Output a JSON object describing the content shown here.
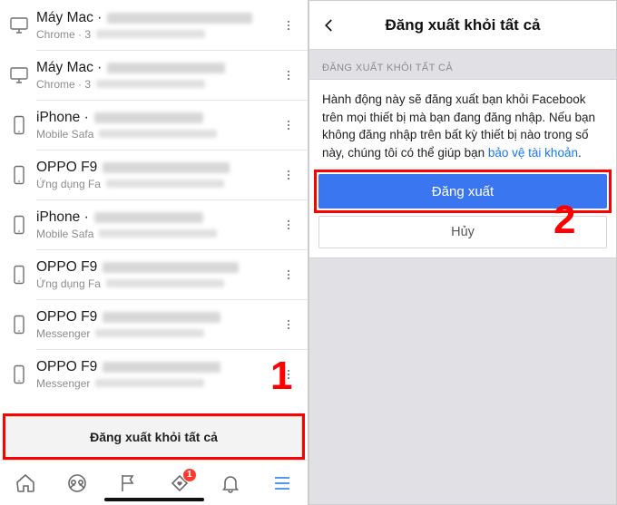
{
  "left": {
    "sessions": [
      {
        "icon": "monitor",
        "title": "Máy Mac ·",
        "title_blur_w": 160,
        "sub": "Chrome · 3",
        "sub_blur_w": 120
      },
      {
        "icon": "monitor",
        "title": "Máy Mac ·",
        "title_blur_w": 130,
        "sub": "Chrome · 3",
        "sub_blur_w": 120
      },
      {
        "icon": "phone",
        "title": "iPhone ·",
        "title_blur_w": 120,
        "sub": "Mobile Safa",
        "sub_blur_w": 130
      },
      {
        "icon": "phone",
        "title": "OPPO F9",
        "title_blur_w": 140,
        "sub": "Ứng dụng Fa",
        "sub_blur_w": 130
      },
      {
        "icon": "phone",
        "title": "iPhone ·",
        "title_blur_w": 120,
        "sub": "Mobile Safa",
        "sub_blur_w": 130
      },
      {
        "icon": "phone",
        "title": "OPPO F9",
        "title_blur_w": 150,
        "sub": "Ứng dụng Fa",
        "sub_blur_w": 130
      },
      {
        "icon": "phone",
        "title": "OPPO F9",
        "title_blur_w": 130,
        "sub": "Messenger",
        "sub_blur_w": 120
      },
      {
        "icon": "phone",
        "title": "OPPO F9",
        "title_blur_w": 130,
        "sub": "Messenger",
        "sub_blur_w": 120
      }
    ],
    "logout_all": "Đăng xuất khỏi tất cả",
    "tab_badge": "1"
  },
  "right": {
    "title": "Đăng xuất khỏi tất cả",
    "section": "ĐĂNG XUẤT KHỎI TẤT CẢ",
    "desc_pre": "Hành động này sẽ đăng xuất bạn khỏi Facebook trên mọi thiết bị mà bạn đang đăng nhập. Nếu bạn không đăng nhập trên bất kỳ thiết bị nào trong số này, chúng tôi có thể giúp bạn ",
    "desc_link": "bảo vệ tài khoản",
    "desc_post": ".",
    "primary": "Đăng xuất",
    "secondary": "Hủy"
  },
  "ann": {
    "one": "1",
    "two": "2"
  }
}
